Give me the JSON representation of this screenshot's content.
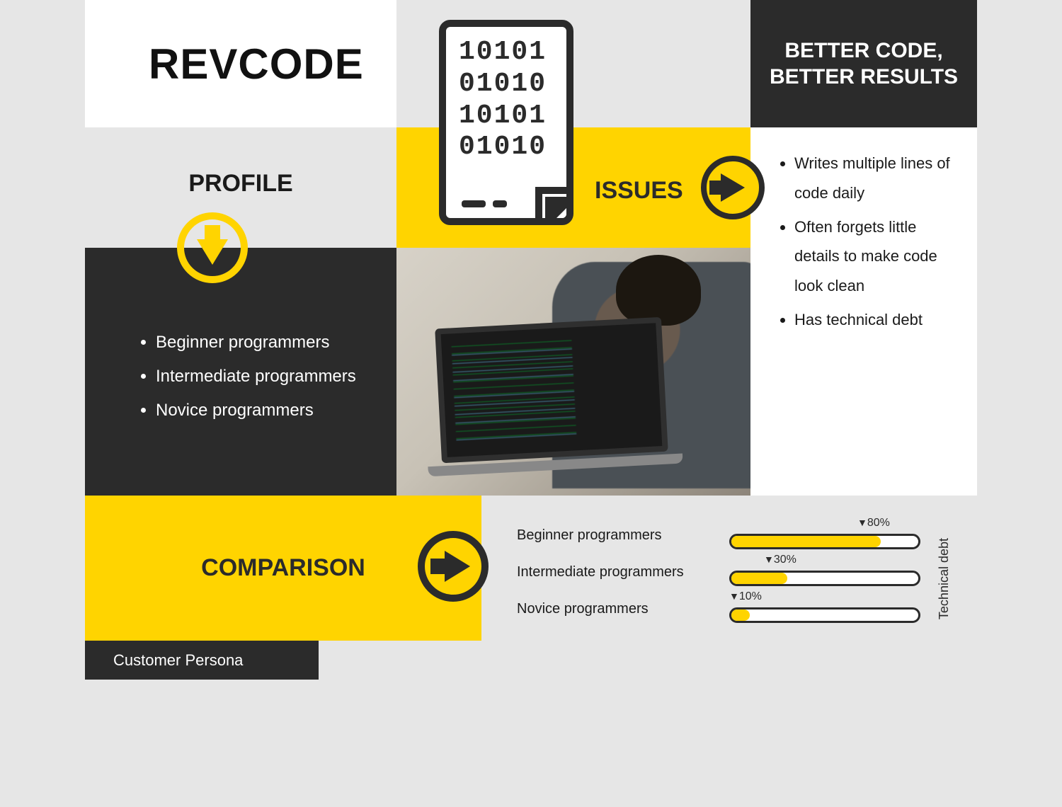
{
  "brand": {
    "name": "REVCODE"
  },
  "tagline": {
    "line1": "BETTER CODE,",
    "line2": "BETTER RESULTS"
  },
  "profile": {
    "heading": "PROFILE",
    "items": [
      "Beginner programmers",
      "Intermediate programmers",
      "Novice programmers"
    ]
  },
  "issues": {
    "heading": "ISSUES",
    "items": [
      "Writes multiple lines of code daily",
      "Often forgets little details to make code look clean",
      "Has technical debt"
    ]
  },
  "binary": {
    "row1": "10101",
    "row2": "01010",
    "row3": "10101",
    "row4": "01010"
  },
  "comparison": {
    "heading": "COMPARISON",
    "axis_label": "Technical debt",
    "rows": [
      {
        "label": "Beginner programmers",
        "pct": 80,
        "pct_label": "80%"
      },
      {
        "label": "Intermediate programmers",
        "pct": 30,
        "pct_label": "30%"
      },
      {
        "label": "Novice programmers",
        "pct": 10,
        "pct_label": "10%"
      }
    ]
  },
  "footer": {
    "label": "Customer Persona"
  },
  "colors": {
    "accent": "#ffd400",
    "dark": "#2b2b2b",
    "light": "#e6e6e6"
  },
  "chart_data": {
    "type": "bar",
    "title": "Technical debt",
    "categories": [
      "Beginner programmers",
      "Intermediate programmers",
      "Novice programmers"
    ],
    "values": [
      80,
      30,
      10
    ],
    "xlabel": "",
    "ylabel": "Technical debt",
    "ylim": [
      0,
      100
    ]
  }
}
